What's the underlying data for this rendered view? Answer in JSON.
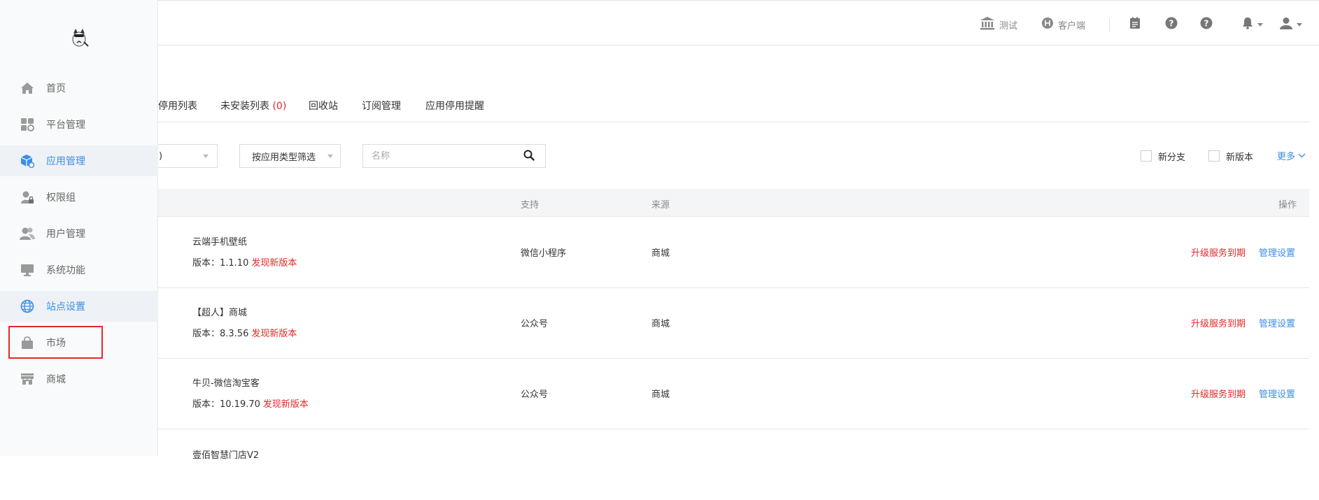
{
  "header": {
    "test_label": "测试",
    "client_label": "客户端"
  },
  "sidebar": {
    "items": [
      {
        "label": "首页",
        "icon": "home-icon"
      },
      {
        "label": "平台管理",
        "icon": "platform-icon"
      },
      {
        "label": "应用管理",
        "icon": "app-cube-icon"
      },
      {
        "label": "权限组",
        "icon": "user-lock-icon"
      },
      {
        "label": "用户管理",
        "icon": "users-icon"
      },
      {
        "label": "系统功能",
        "icon": "monitor-icon"
      },
      {
        "label": "站点设置",
        "icon": "globe-icon"
      },
      {
        "label": "市场",
        "icon": "shopping-bag-icon"
      },
      {
        "label": "商城",
        "icon": "store-icon"
      }
    ]
  },
  "tabs": {
    "disabled_list": "停用列表",
    "uninstalled_list": "未安装列表",
    "uninstalled_count": "(0)",
    "recycle_bin": "回收站",
    "subscription": "订阅管理",
    "disable_reminder": "应用停用提醒"
  },
  "filters": {
    "first_select_value": ")",
    "type_select": "按应用类型筛选",
    "search_placeholder": "名称",
    "new_branch": "新分支",
    "new_version": "新版本",
    "more": "更多"
  },
  "table": {
    "headers": {
      "support": "支持",
      "source": "来源",
      "action": "操作"
    },
    "rows": [
      {
        "name": "云端手机壁纸",
        "version": "版本：1.1.10",
        "new_version": "发现新版本",
        "support": "微信小程序",
        "source": "商城",
        "upgrade": "升级服务到期",
        "manage": "管理设置"
      },
      {
        "name": "【超人】商城",
        "version": "版本：8.3.56",
        "new_version": "发现新版本",
        "support": "公众号",
        "source": "商城",
        "upgrade": "升级服务到期",
        "manage": "管理设置"
      },
      {
        "name": "牛贝-微信淘宝客",
        "version": "版本：10.19.70",
        "new_version": "发现新版本",
        "support": "公众号",
        "source": "商城",
        "upgrade": "升级服务到期",
        "manage": "管理设置"
      },
      {
        "name": "壹佰智慧门店V2"
      }
    ]
  },
  "colors": {
    "accent": "#3b8ee6",
    "danger": "#e12a2a",
    "sidebar_bg": "#f9fafb"
  }
}
